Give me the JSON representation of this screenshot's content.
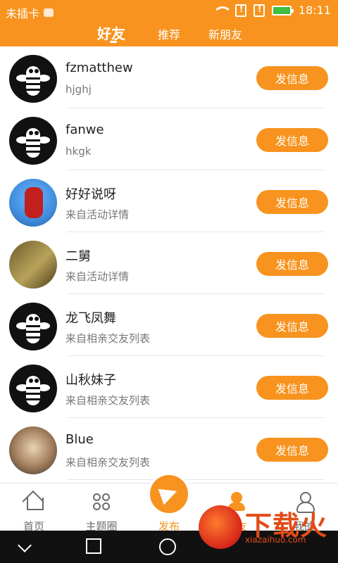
{
  "status_bar": {
    "carrier_text": "未插卡",
    "time": "18:11"
  },
  "header": {
    "tabs": [
      {
        "label": "好友",
        "active": true
      },
      {
        "label": "推荐",
        "active": false
      },
      {
        "label": "新朋友",
        "active": false
      }
    ]
  },
  "friends": [
    {
      "name": "fzmatthew",
      "sub": "hjghj",
      "button": "发信息",
      "avatar": "bee-logo"
    },
    {
      "name": "fanwe",
      "sub": "hkgk",
      "button": "发信息",
      "avatar": "bee-logo"
    },
    {
      "name": "好好说呀",
      "sub": "来自活动详情",
      "button": "发信息",
      "avatar": "photo"
    },
    {
      "name": "二舅",
      "sub": "来自活动详情",
      "button": "发信息",
      "avatar": "photo"
    },
    {
      "name": "龙飞凤舞",
      "sub": "来自相亲交友列表",
      "button": "发信息",
      "avatar": "bee-logo"
    },
    {
      "name": "山秋妹子",
      "sub": "来自相亲交友列表",
      "button": "发信息",
      "avatar": "bee-logo"
    },
    {
      "name": "Blue",
      "sub": "来自相亲交友列表",
      "button": "发信息",
      "avatar": "photo"
    }
  ],
  "bottom_nav": {
    "items": [
      {
        "label": "首页",
        "icon": "home-icon"
      },
      {
        "label": "主题圈",
        "icon": "grid-icon"
      },
      {
        "label": "发布",
        "icon": "paper-plane-icon"
      },
      {
        "label": "好友",
        "icon": "friends-icon",
        "active": true
      },
      {
        "label": "我的",
        "icon": "person-icon"
      }
    ]
  },
  "watermark": {
    "brand": "下载火",
    "url": "xiazaihuo.com"
  },
  "colors": {
    "accent": "#f7931e",
    "text_primary": "#222222",
    "text_secondary": "#777777"
  }
}
